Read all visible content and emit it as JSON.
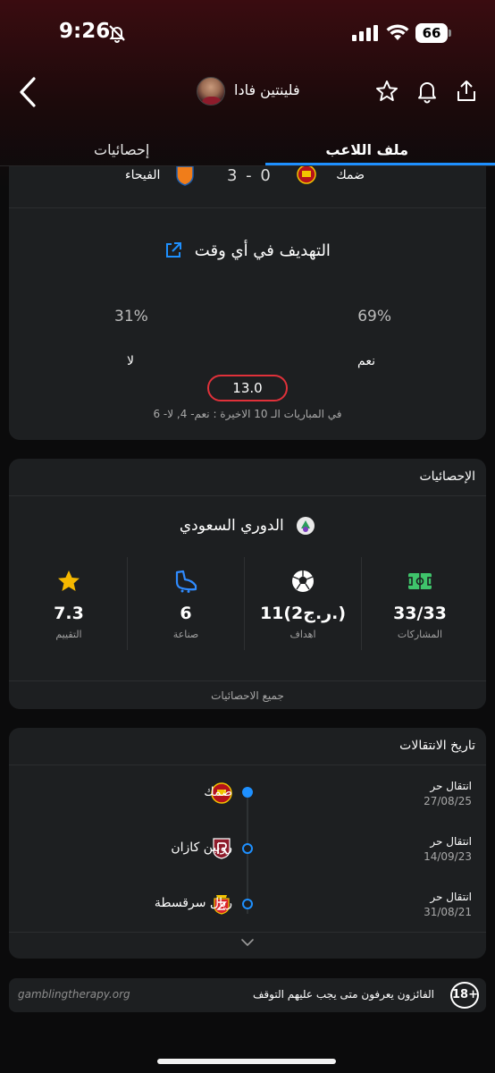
{
  "status_bar": {
    "time": "9:26",
    "battery": "66"
  },
  "header": {
    "player_name": "فلينتين فادا"
  },
  "tabs": [
    {
      "label": "ملف اللاعب"
    },
    {
      "label": "إحصائيات"
    }
  ],
  "match": {
    "home_team": "ضمك",
    "score": "3 - 0",
    "away_team": "الفيحاء"
  },
  "prop": {
    "title": "التهديف في أي وقت",
    "yes_pct": "69%",
    "no_pct": "31%",
    "yes_label": "نعم",
    "no_label": "لا",
    "odds": "13.0",
    "last10": "في المباريات الـ 10 الاخيرة : نعم- 4, لا- 6"
  },
  "stats": {
    "header": "الإحصائيات",
    "league": "الدوري السعودي",
    "items": [
      {
        "value": "33/33",
        "label": "المشاركات",
        "icon": "pitch-icon",
        "color": "#3fc46b"
      },
      {
        "value": "11(2ر.ج.)",
        "label": "اهداف",
        "icon": "football-icon",
        "color": "#ffffff"
      },
      {
        "value": "6",
        "label": "صناعة",
        "icon": "boot-icon",
        "color": "#2f8bff"
      },
      {
        "value": "7.3",
        "label": "التقييم",
        "icon": "star-icon",
        "color": "#f5b800"
      }
    ],
    "all_stats": "جميع الاحصائيات"
  },
  "transfers": {
    "header": "تاريخ الانتقالات",
    "items": [
      {
        "type": "انتقال حر",
        "date": "27/08/25",
        "club": "ضمك",
        "current": true
      },
      {
        "type": "انتقال حر",
        "date": "14/09/23",
        "club": "روبين كازان",
        "current": false
      },
      {
        "type": "انتقال حر",
        "date": "31/08/21",
        "club": "ريال سرقسطة",
        "current": false
      }
    ]
  },
  "footer": {
    "link": "gamblingtherapy.org",
    "text": "الفائزون يعرفون متى يجب عليهم التوقف",
    "age": "18+"
  },
  "colors": {
    "accent": "#1e90ff",
    "odds_border": "#e0313a",
    "card_bg": "#1d1f21"
  }
}
